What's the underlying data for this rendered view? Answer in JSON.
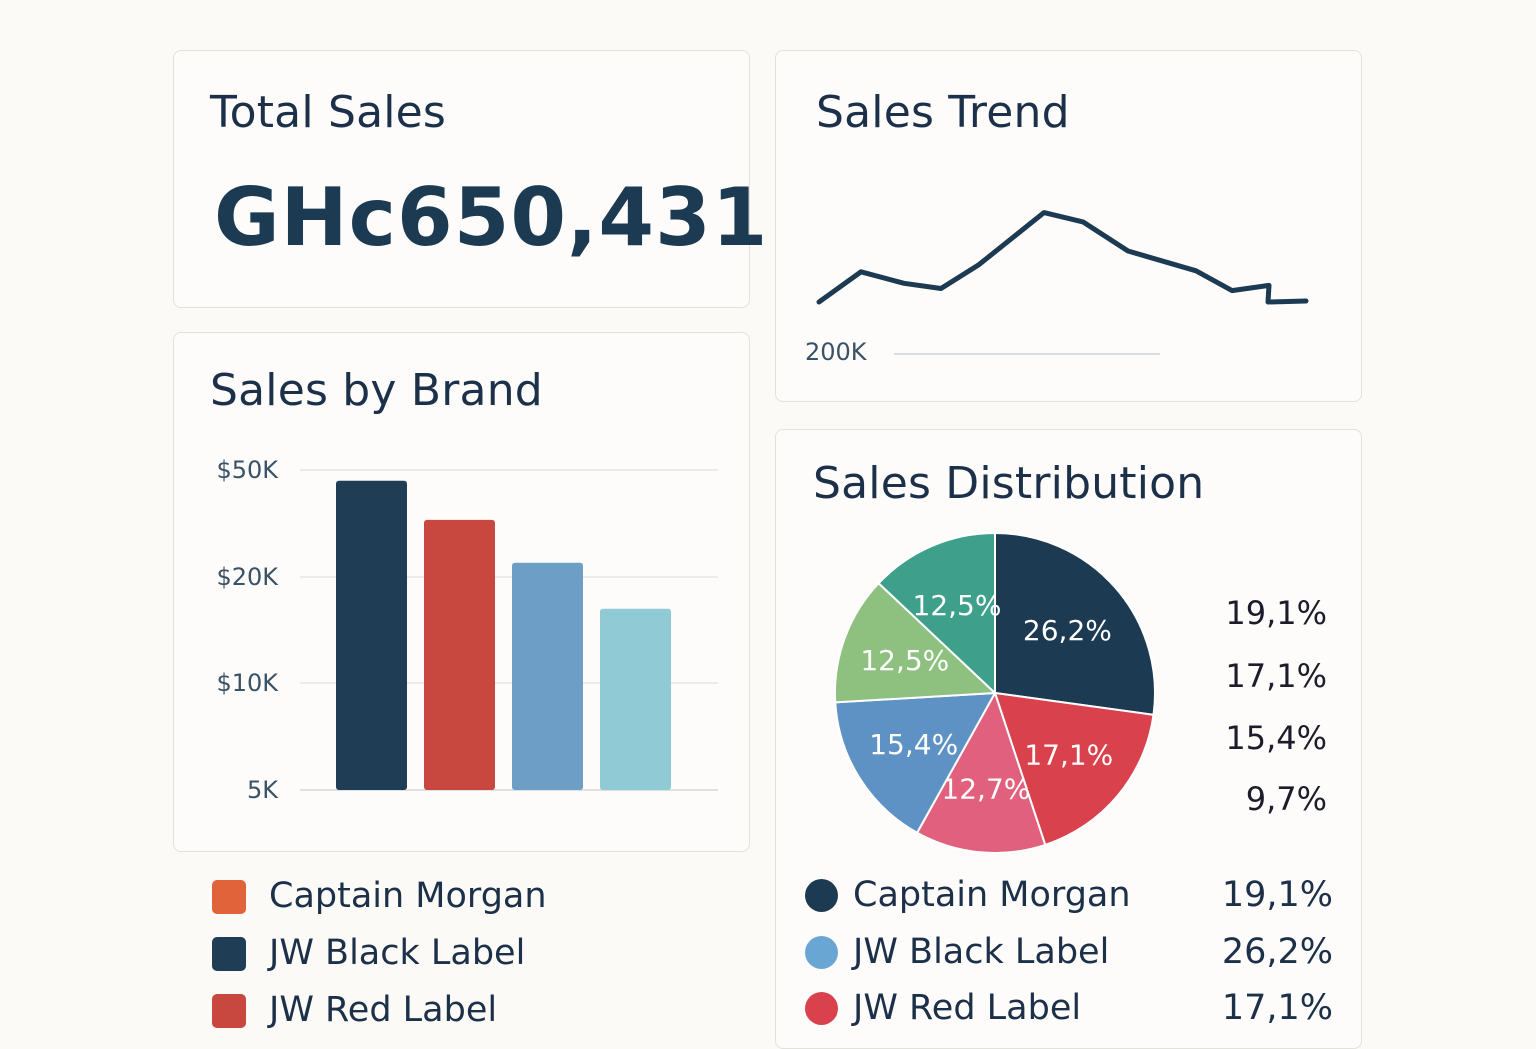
{
  "total_sales": {
    "title": "Total Sales",
    "value": "GHc650,431"
  },
  "sales_trend": {
    "title": "Sales Trend",
    "axis_label": "200K"
  },
  "sales_by_brand": {
    "title": "Sales by Brand",
    "legend": [
      {
        "label": "Captain Morgan",
        "color": "#e0633a"
      },
      {
        "label": "JW Black Label",
        "color": "#1f3e56"
      },
      {
        "label": "JW Red Label",
        "color": "#c8473f"
      }
    ]
  },
  "sales_distribution": {
    "title": "Sales Distribution",
    "side_values": [
      "19,1%",
      "17,1%",
      "15,4%",
      "9,7%"
    ],
    "legend": [
      {
        "label": "Captain Morgan",
        "value": "19,1%",
        "color": "#1c3a52"
      },
      {
        "label": "JW Black Label",
        "value": "26,2%",
        "color": "#6aa6d4"
      },
      {
        "label": "JW Red Label",
        "value": "17,1%",
        "color": "#d9414d"
      }
    ]
  },
  "chart_data": [
    {
      "type": "line",
      "title": "Sales Trend",
      "y_tick_labels": [
        "200K"
      ],
      "values": [
        0.0,
        0.29,
        0.18,
        0.13,
        0.36,
        0.86,
        0.77,
        0.49,
        0.3,
        0.11,
        0.16,
        0.0,
        0.01
      ],
      "value_note": "relative level (no y scale printed beyond 200K)",
      "line_color": "#1c3a52"
    },
    {
      "type": "bar",
      "title": "Sales by Brand",
      "y_tick_labels": [
        "$50K",
        "$20K",
        "$10K",
        "5K"
      ],
      "categories": [
        "",
        "",
        "",
        ""
      ],
      "values": [
        47,
        36,
        24,
        17
      ],
      "value_note": "read against the printed ticks; axis is non-linear",
      "colors": [
        "#1f3e56",
        "#c8473f",
        "#6d9fc6",
        "#8fcad5"
      ]
    },
    {
      "type": "pie",
      "title": "Sales Distribution",
      "slices": [
        {
          "label": "26,2%",
          "value": 26.2,
          "color": "#1c3a52"
        },
        {
          "label": "17,1%",
          "value": 17.1,
          "color": "#d9414d"
        },
        {
          "label": "12,7%",
          "value": 12.7,
          "color": "#e0607d"
        },
        {
          "label": "15,4%",
          "value": 15.4,
          "color": "#5f92c4"
        },
        {
          "label": "12,5%",
          "value": 12.5,
          "color": "#8ec07f"
        },
        {
          "label": "12,5%",
          "value": 12.5,
          "color": "#3ea08a"
        }
      ],
      "start": "top",
      "direction": "clockwise"
    }
  ]
}
